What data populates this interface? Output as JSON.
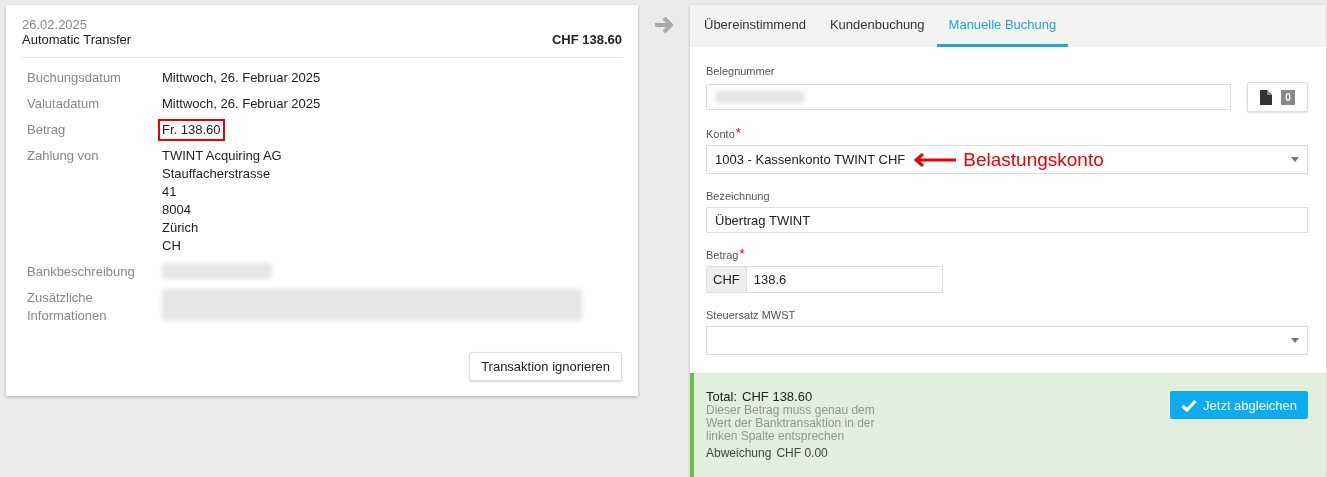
{
  "transaction": {
    "date": "26.02.2025",
    "title": "Automatic Transfer",
    "amount": "CHF  138.60",
    "rows": [
      {
        "label": "Buchungsdatum",
        "lines": [
          "Mittwoch, 26. Februar 2025"
        ]
      },
      {
        "label": "Valutadatum",
        "lines": [
          "Mittwoch, 26. Februar 2025"
        ]
      },
      {
        "label": "Betrag",
        "lines": [
          "Fr. 138.60"
        ],
        "highlighted": true
      },
      {
        "label": "Zahlung von",
        "lines": [
          "TWINT Acquiring AG",
          "Stauffacherstrasse",
          "41",
          "8004",
          "Zürich",
          "CH"
        ]
      },
      {
        "label": "Bankbeschreibung",
        "lines": [],
        "redacted": true
      },
      {
        "label": "Zusätzliche Informationen",
        "lines": [],
        "redacted": true
      }
    ],
    "ignore_button": "Transaktion ignorieren"
  },
  "tabs": [
    {
      "label": "Übereinstimmend",
      "selected": false
    },
    {
      "label": "Kundenbuchung",
      "selected": false
    },
    {
      "label": "Manuelle Buchung",
      "selected": true
    }
  ],
  "form": {
    "fields": [
      {
        "kind": "text",
        "label": "Belegnummer",
        "redacted": true,
        "attachments": "0"
      },
      {
        "kind": "select",
        "label": "Konto",
        "required_mark": "*",
        "value": "1003 - Kassenkonto TWINT CHF",
        "annotation": "Belastungskonto"
      },
      {
        "kind": "text",
        "label": "Bezeichnung",
        "value": "Übertrag TWINT"
      },
      {
        "kind": "currency",
        "label": "Betrag",
        "required_mark": "*",
        "currency": "CHF",
        "value": "138.6"
      },
      {
        "kind": "select",
        "label": "Steuersatz MWST"
      }
    ]
  },
  "footer": {
    "total_label": "Total:",
    "total": "CHF  138.60",
    "hint": "Dieser Betrag muss genau dem Wert der Banktransaktion in der linken Spalte entsprechen",
    "deviation_label": "Abweichung",
    "deviation": "CHF  0.00",
    "button": "Jetzt abgleichen"
  }
}
